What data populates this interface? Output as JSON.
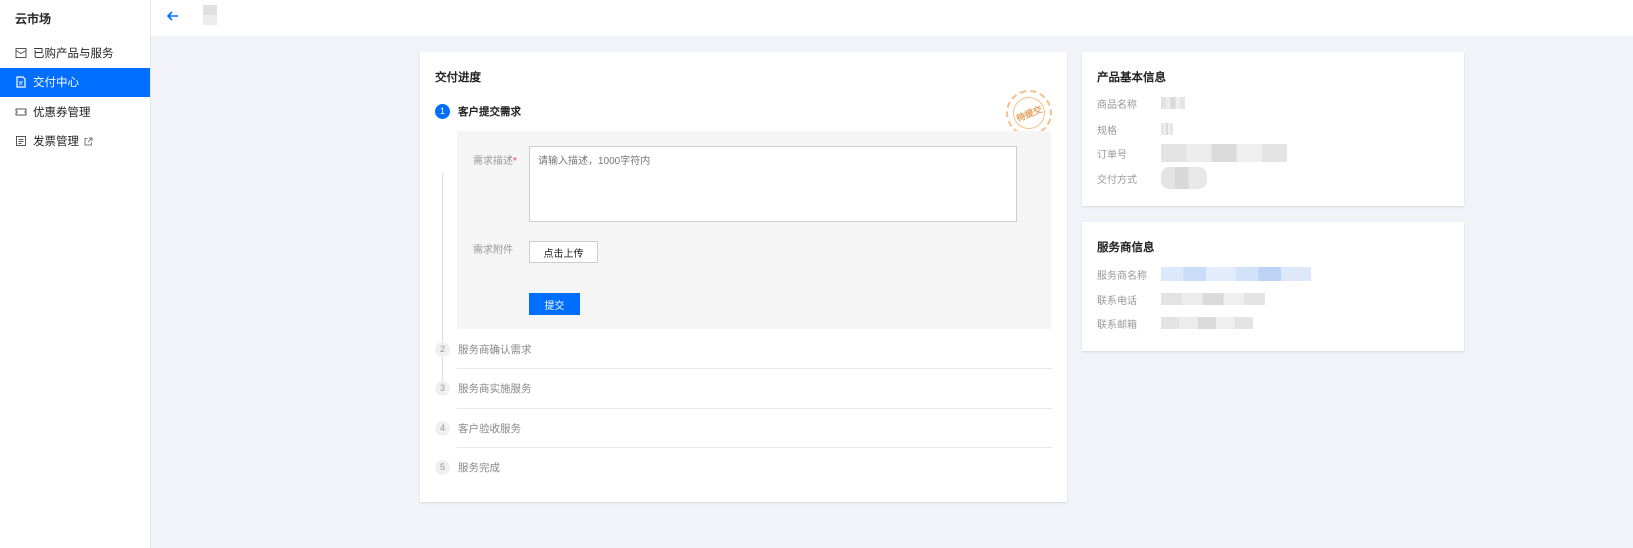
{
  "sidebar": {
    "title": "云市场",
    "items": [
      {
        "label": "已购产品与服务",
        "icon": "box-icon",
        "active": false
      },
      {
        "label": "交付中心",
        "icon": "document-icon",
        "active": true
      },
      {
        "label": "优惠券管理",
        "icon": "ticket-icon",
        "active": false
      },
      {
        "label": "发票管理",
        "icon": "invoice-icon",
        "active": false,
        "external": true
      }
    ]
  },
  "topbar": {
    "back_icon": "arrow-left-icon"
  },
  "progress": {
    "title": "交付进度",
    "stamp_text": "待提交",
    "steps": [
      {
        "num": "1",
        "label": "客户提交需求",
        "active": true
      },
      {
        "num": "2",
        "label": "服务商确认需求",
        "active": false
      },
      {
        "num": "3",
        "label": "服务商实施服务",
        "active": false
      },
      {
        "num": "4",
        "label": "客户验收服务",
        "active": false
      },
      {
        "num": "5",
        "label": "服务完成",
        "active": false
      }
    ],
    "form": {
      "desc_label": "需求描述",
      "required_mark": "*",
      "desc_placeholder": "请输入描述，1000字符内",
      "attach_label": "需求附件",
      "upload_label": "点击上传",
      "submit_label": "提交"
    }
  },
  "product_info": {
    "title": "产品基本信息",
    "rows": [
      {
        "label": "商品名称"
      },
      {
        "label": "规格"
      },
      {
        "label": "订单号"
      },
      {
        "label": "交付方式"
      }
    ]
  },
  "vendor_info": {
    "title": "服务商信息",
    "rows": [
      {
        "label": "服务商名称"
      },
      {
        "label": "联系电话"
      },
      {
        "label": "联系邮箱"
      }
    ]
  },
  "colors": {
    "accent": "#006eff",
    "stamp": "#f5c089"
  }
}
